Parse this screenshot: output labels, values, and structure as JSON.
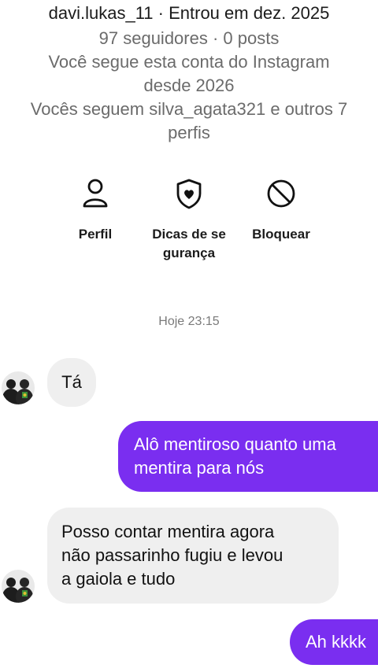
{
  "profile": {
    "title_line": "davi.lukas_11 · Entrou em dez. 2025",
    "stats": "97 seguidores · 0 posts",
    "follow_since_1": "Você segue esta conta do Instagram",
    "follow_since_2": "desde 2026",
    "mutuals_1": "Vocês seguem silva_agata321 e outros 7",
    "mutuals_2": "perfis"
  },
  "actions": {
    "profile_label": "Perfil",
    "safety_label": "Dicas de segurança",
    "block_label": "Bloquear"
  },
  "chat": {
    "timestamp": "Hoje 23:15",
    "messages": [
      {
        "from": "them",
        "lines": [
          "Tá"
        ]
      },
      {
        "from": "me",
        "lines": [
          "Alô mentiroso quanto uma",
          "mentira para nós"
        ]
      },
      {
        "from": "them",
        "lines": [
          "Posso  contar mentira agora",
          "não passarinho fugiu e levou",
          "a gaiola e tudo"
        ]
      },
      {
        "from": "me",
        "lines": [
          "Ah kkkk"
        ]
      }
    ]
  },
  "colors": {
    "outgoing_bubble": "#7a2ef0",
    "incoming_bubble": "#efefef"
  }
}
